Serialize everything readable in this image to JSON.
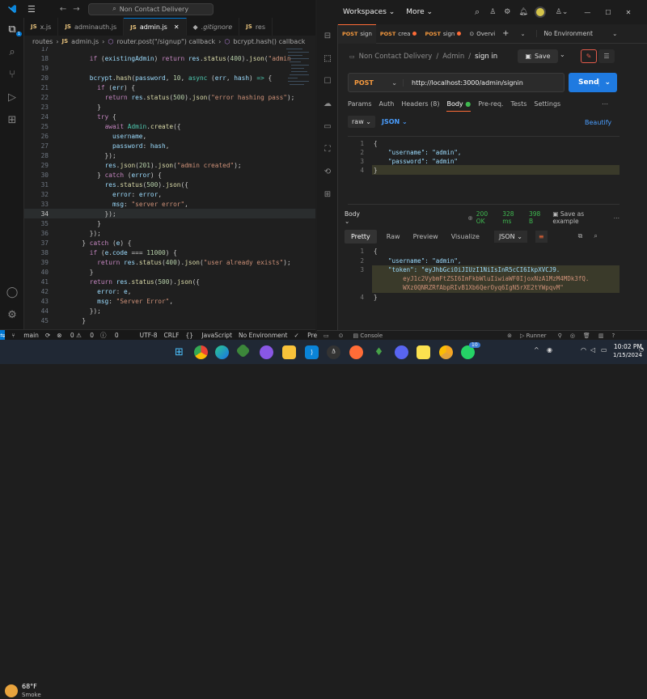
{
  "vscode": {
    "search_text": "Non Contact Delivery",
    "tabs": [
      {
        "label": "x.js",
        "active": false
      },
      {
        "label": "adminauth.js",
        "active": false
      },
      {
        "label": "admin.js",
        "active": true
      },
      {
        "label": ".gitignore",
        "active": false
      },
      {
        "label": "res",
        "active": false
      }
    ],
    "breadcrumb": [
      "routes",
      "admin.js",
      "router.post(\"/signup\") callback",
      "bcrypt.hash() callback"
    ],
    "line_numbers": [
      "17",
      "18",
      "19",
      "20",
      "21",
      "22",
      "23",
      "24",
      "25",
      "26",
      "27",
      "28",
      "29",
      "30",
      "31",
      "32",
      "33",
      "34",
      "35",
      "36",
      "37",
      "38",
      "39",
      "40",
      "41",
      "42",
      "43",
      "44",
      "45"
    ],
    "status": {
      "branch": "main",
      "errors": "0",
      "warnings": "0",
      "info": "0",
      "encoding": "UTF-8",
      "eol": "CRLF",
      "language": "JavaScript",
      "environment": "No Environment",
      "formatter": "Prettier"
    }
  },
  "postman": {
    "workspaces_label": "Workspaces",
    "more_label": "More",
    "tabs": [
      {
        "method": "POST",
        "label": "sign"
      },
      {
        "method": "POST",
        "label": "crea"
      },
      {
        "method": "POST",
        "label": "sign"
      },
      {
        "method": "",
        "label": "Overvi"
      }
    ],
    "environment": "No Environment",
    "breadcrumb": {
      "collection": "Non Contact Delivery",
      "folder": "Admin",
      "request": "sign in"
    },
    "save_label": "Save",
    "method": "POST",
    "url": "http://localhost:3000/admin/signin",
    "send_label": "Send",
    "request_tabs": [
      "Params",
      "Auth",
      "Headers (8)",
      "Body",
      "Pre-req.",
      "Tests",
      "Settings"
    ],
    "body_mode": "raw",
    "body_format": "JSON",
    "beautify_label": "Beautify",
    "request_body_lines": [
      "{",
      "    \"username\": \"admin\",",
      "    \"password\": \"admin\"",
      "}"
    ],
    "request_line_numbers": [
      "1",
      "2",
      "3",
      "4"
    ],
    "response": {
      "label": "Body",
      "status": "200 OK",
      "time": "328 ms",
      "size": "398 B",
      "save_example": "Save as example",
      "view_tabs": [
        "Pretty",
        "Raw",
        "Preview",
        "Visualize"
      ],
      "format": "JSON",
      "line_numbers": [
        "1",
        "2",
        "3",
        "",
        "",
        "4"
      ],
      "lines": [
        "{",
        "    \"username\": \"admin\",",
        "    \"token\": \"eyJhbGciOiJIUzI1NiIsInR5cCI6IkpXVCJ9.",
        "        eyJ1c2VybmFtZSI6ImFkbWluIiwiaWF0IjoxNzA1MzM4MDk3fQ.",
        "        WXz0QNRZRfAbpRIvB1Xb6QerOyq6IgN5rXE2tYWpqvM\"",
        "}"
      ]
    },
    "status_bar": {
      "console": "Console",
      "runner": "Runner"
    }
  },
  "taskbar": {
    "weather_temp": "68°F",
    "weather_desc": "Smoke",
    "time": "10:02 PM",
    "date": "1/15/2024",
    "notification_badge": "10"
  }
}
